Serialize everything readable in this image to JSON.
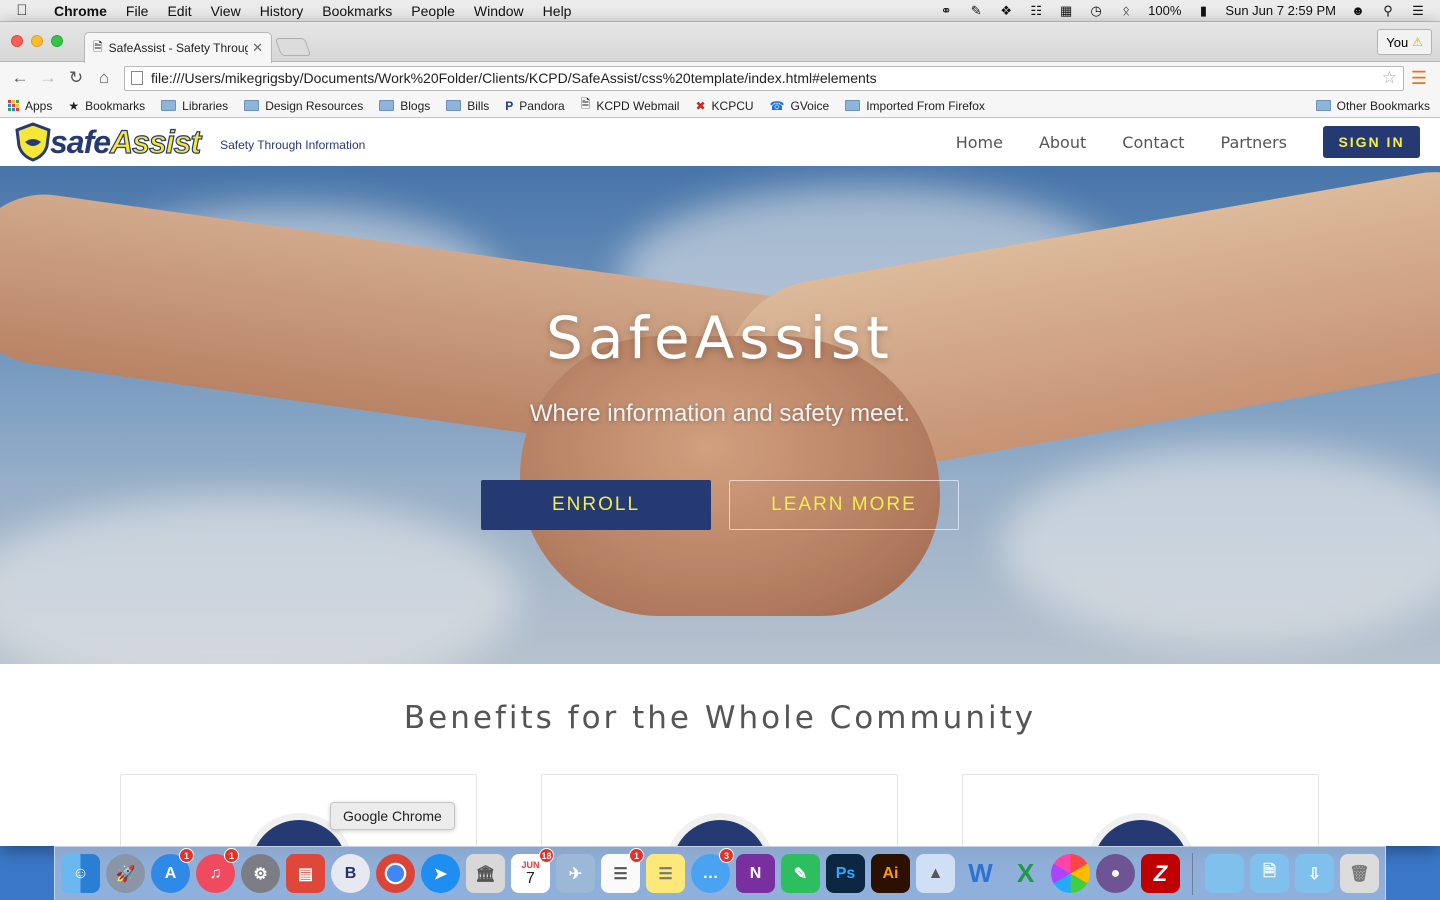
{
  "menubar": {
    "app_name": "Chrome",
    "menus": [
      "File",
      "Edit",
      "View",
      "History",
      "Bookmarks",
      "People",
      "Window",
      "Help"
    ],
    "battery": "100%",
    "clock": "Sun Jun 7  2:59 PM"
  },
  "browser": {
    "tab_title": "SafeAssist - Safety Through Information",
    "profile_label": "You",
    "url": "file:///Users/mikegrigsby/Documents/Work%20Folder/Clients/KCPD/SafeAssist/css%20template/index.html#elements",
    "bookmarks": [
      "Apps",
      "Bookmarks",
      "Libraries",
      "Design Resources",
      "Blogs",
      "Bills",
      "Pandora",
      "KCPD Webmail",
      "KCPCU",
      "GVoice",
      "Imported From Firefox"
    ],
    "other_bookmarks": "Other Bookmarks"
  },
  "site": {
    "logo_safe": "safe",
    "logo_assist": "Assist",
    "tagline": "Safety Through Information",
    "nav": [
      "Home",
      "About",
      "Contact",
      "Partners"
    ],
    "signin_label": "SIGN IN",
    "hero": {
      "title": "SafeAssist",
      "subtitle": "Where information and safety meet.",
      "enroll_label": "ENROLL",
      "learn_more_label": "LEARN MORE"
    },
    "benefits_title": "Benefits for the Whole Community"
  },
  "dock": {
    "tooltip": "Google Chrome",
    "badges": {
      "app_store": "1",
      "itunes": "1",
      "calendar": "18",
      "reminders": "1",
      "messages": "3"
    },
    "calendar_month": "JUN",
    "calendar_day": "7"
  },
  "colors": {
    "brand_navy": "#253a73",
    "brand_yellow": "#f5ee4a"
  }
}
